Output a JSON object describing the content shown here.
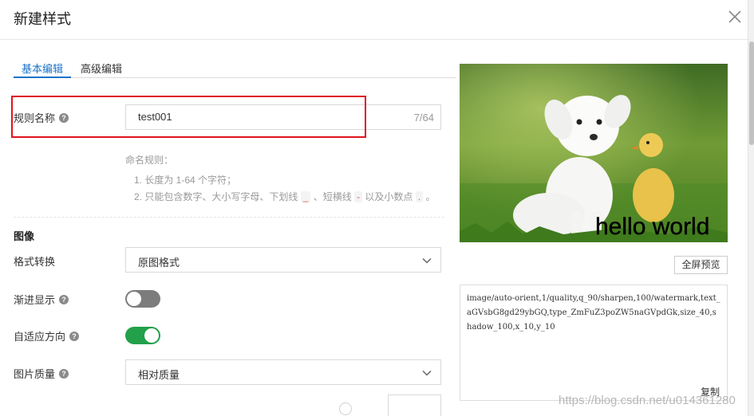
{
  "dialog": {
    "title": "新建样式",
    "close_icon": "close-icon"
  },
  "tabs": [
    {
      "label": "基本编辑",
      "active": true
    },
    {
      "label": "高级编辑",
      "active": false
    }
  ],
  "rule_name": {
    "label": "规则名称",
    "value": "test001",
    "counter": "7/64"
  },
  "naming_rules": {
    "heading": "命名规则：",
    "rule1": "1. 长度为 1-64 个字符；",
    "rule2_part1": "2. 只能包含数字、大小写字母、下划线",
    "underscore": "_",
    "rule2_part2": "、短横线",
    "dash": "-",
    "rule2_part3": "以及小数点",
    "dot": ".",
    "rule2_end": "。"
  },
  "image_section": {
    "title": "图像",
    "format_label": "格式转换",
    "format_value": "原图格式",
    "progressive_label": "渐进显示",
    "progressive_on": false,
    "orient_label": "自适应方向",
    "orient_on": true,
    "quality_label": "图片质量",
    "quality_value": "相对质量"
  },
  "preview": {
    "watermark_text": "hello world",
    "fullscreen_button": "全屏预览",
    "code": "image/auto-orient,1/quality,q_90/sharpen,100/watermark,text_aGVsbG8gd29ybGQ,type_ZmFuZ3poZW5naGVpdGk,size_40,shadow_100,x_10,y_10",
    "copy_label": "复制"
  },
  "footer_watermark": "https://blog.csdn.net/u014361280",
  "colors": {
    "accent": "#1a73c8",
    "highlight_border": "#e0141e",
    "switch_on": "#22a04a",
    "switch_off": "#7c7c7c"
  }
}
